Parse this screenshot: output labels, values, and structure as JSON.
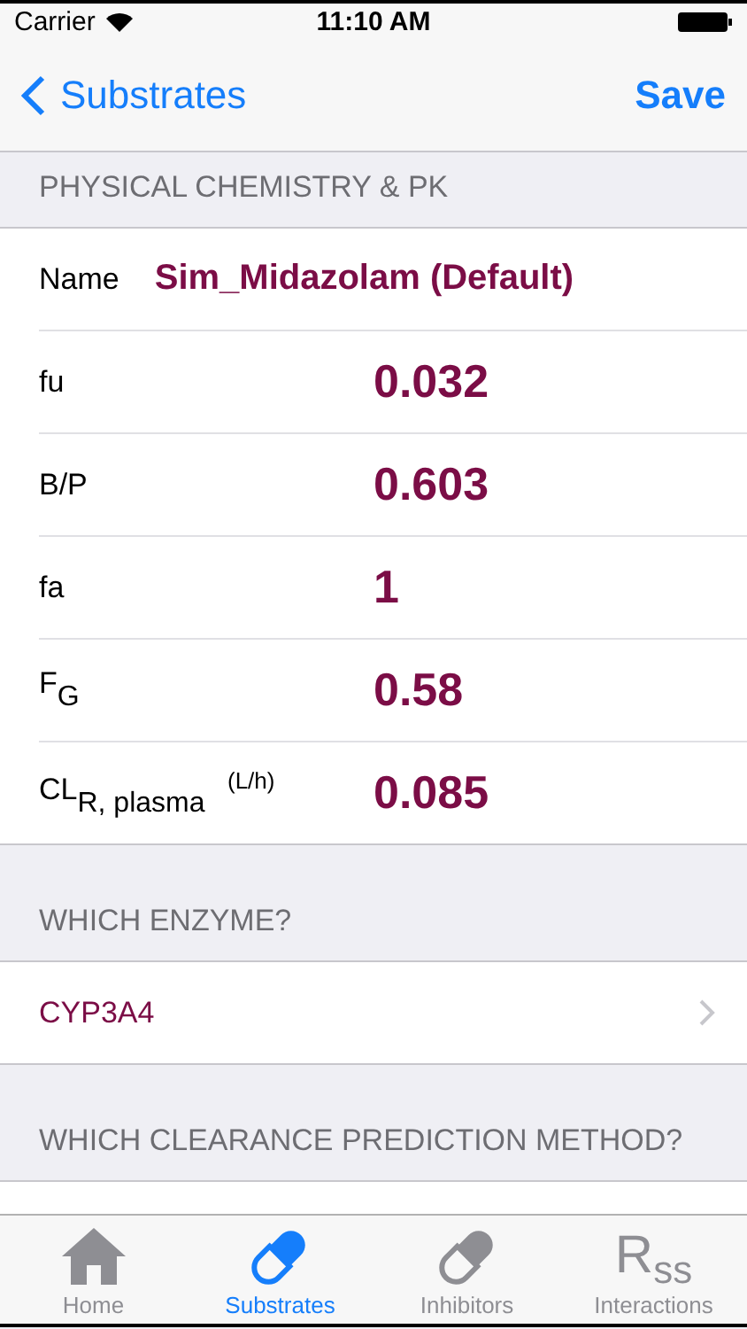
{
  "status_bar": {
    "carrier": "Carrier",
    "time": "11:10 AM"
  },
  "nav": {
    "back": "Substrates",
    "action": "Save"
  },
  "sections": [
    {
      "header": "PHYSICAL CHEMISTRY & PK",
      "rows": [
        {
          "kind": "name",
          "label": "Name",
          "value": "Sim_Midazolam (Default)"
        },
        {
          "kind": "number",
          "label": "fu",
          "value": "0.032"
        },
        {
          "kind": "number",
          "label": "B/P",
          "value": "0.603"
        },
        {
          "kind": "number",
          "label": "fa",
          "value": "1"
        },
        {
          "kind": "number",
          "label": "F$_{G}$",
          "value": "0.58"
        },
        {
          "kind": "number",
          "label": "CL$_{R, plasma}$ $^{(L/h)}$",
          "value": "0.085"
        }
      ]
    },
    {
      "header": "WHICH ENZYME?",
      "rows": [
        {
          "kind": "link",
          "value": "CYP3A4"
        }
      ]
    },
    {
      "header": "WHICH CLEARANCE PREDICTION METHOD?",
      "rows": [
        {
          "kind": "cut"
        }
      ]
    }
  ],
  "tabs": [
    {
      "kind": "home",
      "label": "Home",
      "selected": false
    },
    {
      "kind": "pill",
      "label": "Substrates",
      "selected": true
    },
    {
      "kind": "pill",
      "label": "Inhibitors",
      "selected": false
    },
    {
      "kind": "text",
      "icon_text": "R$_{ss}$",
      "label": "Interactions",
      "selected": false
    }
  ]
}
